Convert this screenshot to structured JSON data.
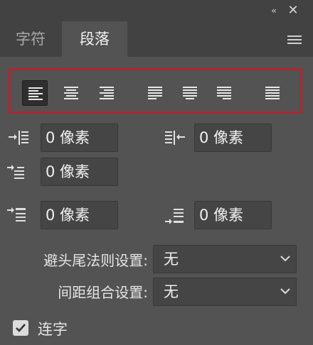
{
  "window": {
    "collapse_glyph": "‹‹",
    "close_glyph": "✕"
  },
  "tabs": [
    {
      "label": "字符"
    },
    {
      "label": "段落"
    }
  ],
  "icons": {
    "menu": "hamburger-menu-icon"
  },
  "fields": {
    "indent_left": "0 像素",
    "indent_right": "0 像素",
    "indent_first_line": "0 像素",
    "space_before": "0 像素",
    "space_after": "0 像素"
  },
  "selects": {
    "kinsoku": {
      "label": "避头尾法则设置:",
      "value": "无"
    },
    "mojikumi": {
      "label": "间距组合设置:",
      "value": "无"
    }
  },
  "hyphenate": {
    "label": "连字",
    "checked": true
  },
  "colors": {
    "panel_bg": "#535353",
    "header_bg": "#424242",
    "field_bg": "#454545",
    "highlight_border": "#b12630"
  }
}
